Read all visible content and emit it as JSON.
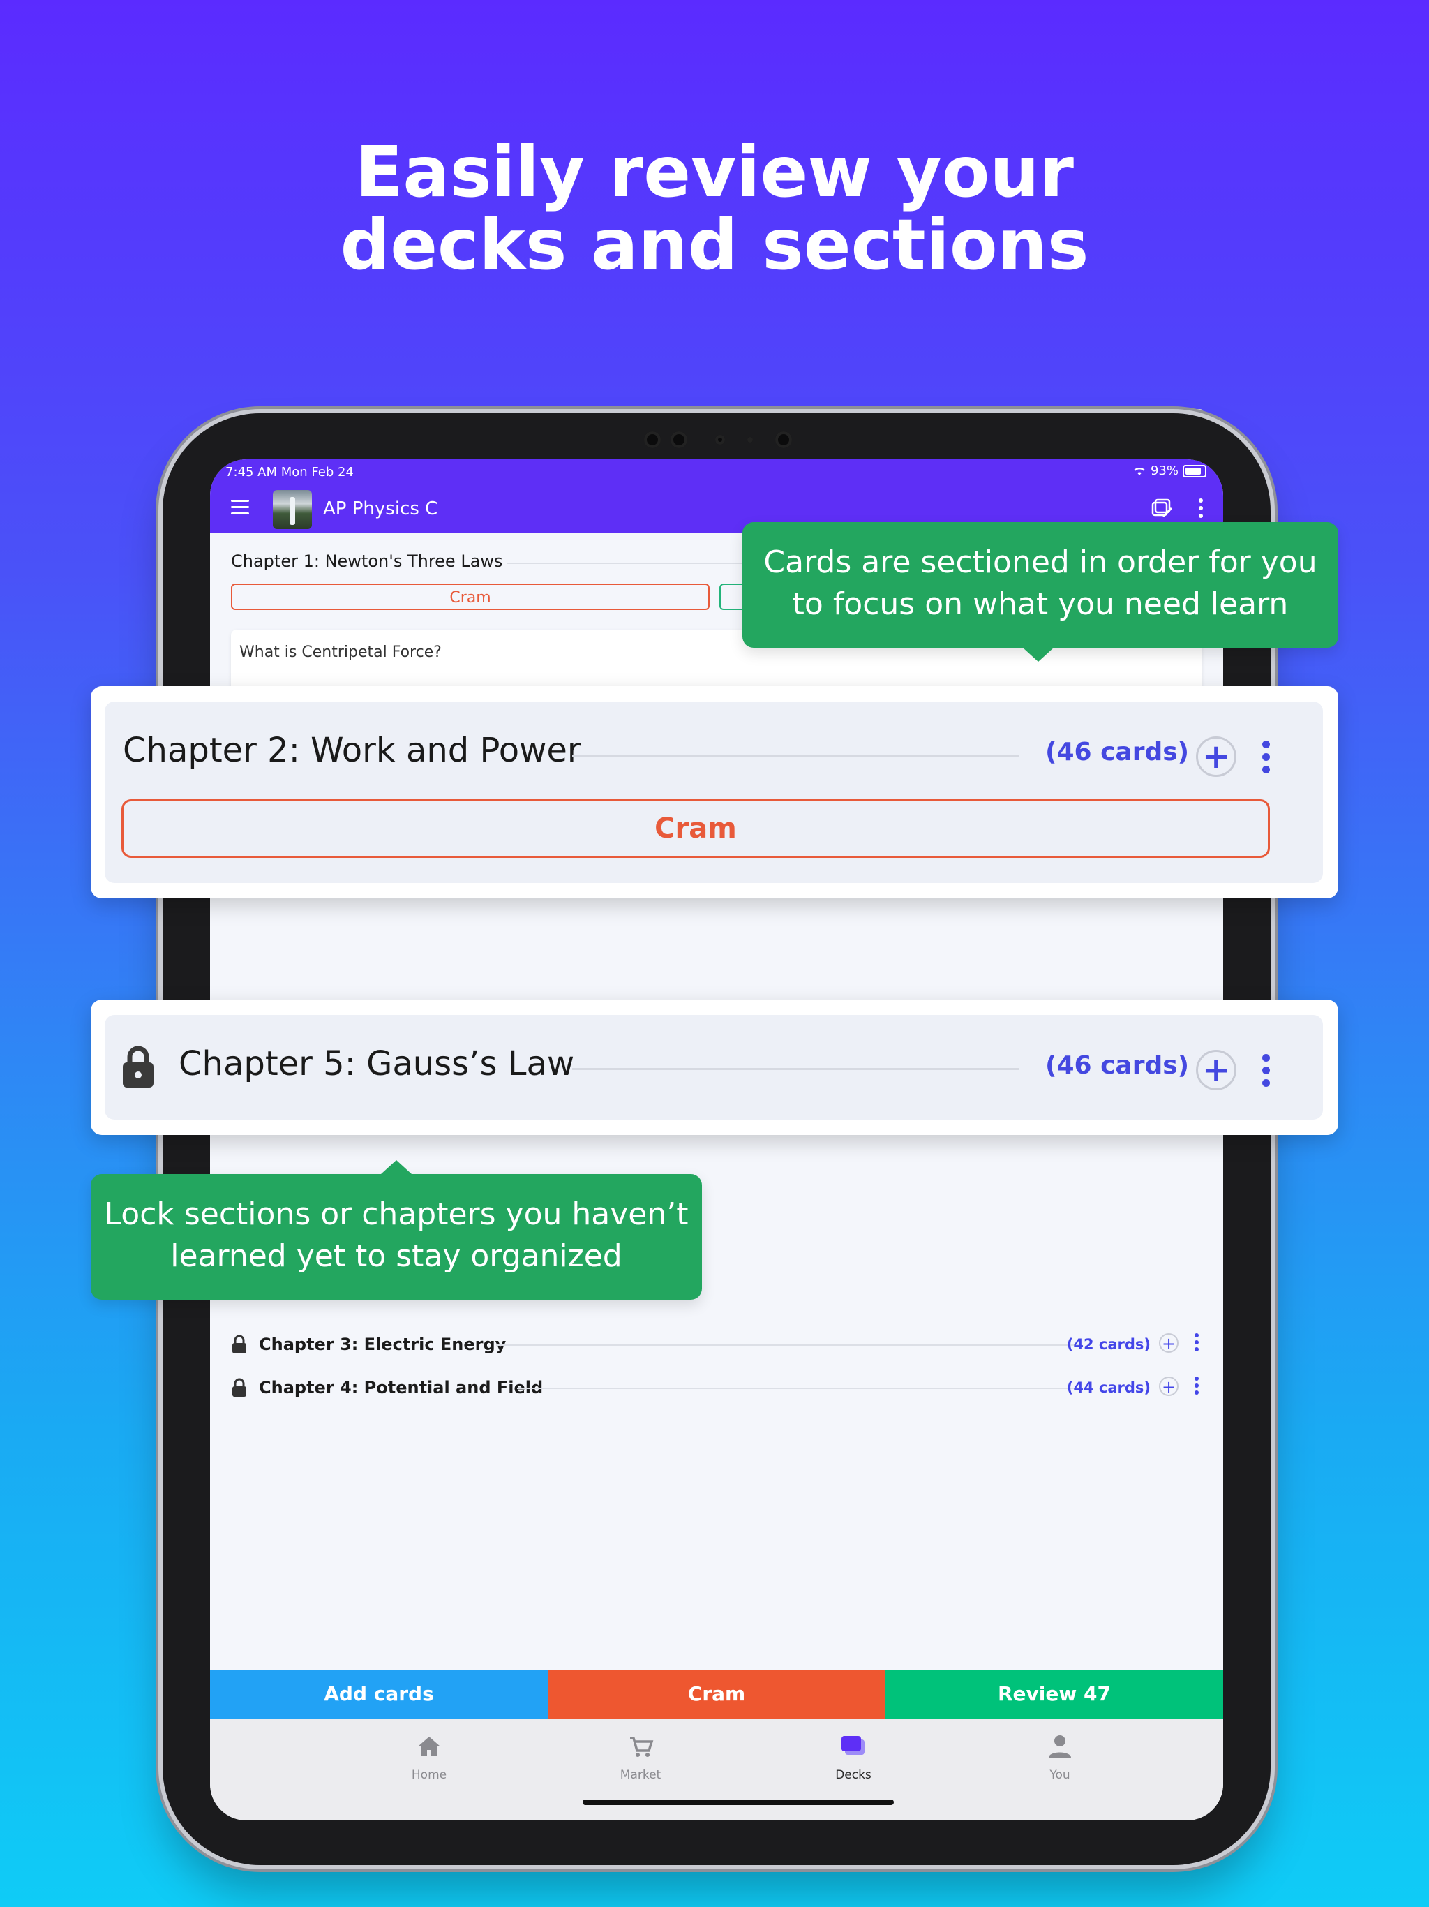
{
  "headline": {
    "line1": "Easily review your",
    "line2": "decks and sections"
  },
  "status_bar": {
    "time": "7:45 AM   Mon Feb 24",
    "battery": "93%"
  },
  "app_bar": {
    "deck_title": "AP Physics C"
  },
  "chapter1": {
    "title": "Chapter 1: Newton's Three Laws",
    "cram_label": "Cram",
    "card_question": "What is Centripetal Force?"
  },
  "sections": [
    {
      "title": "Chapter 3: Electric Energy",
      "count": "(42 cards)",
      "locked": true
    },
    {
      "title": "Chapter 4: Potential and Field",
      "count": "(44 cards)",
      "locked": true
    }
  ],
  "callout_chapter2": {
    "title": "Chapter 2: Work and Power",
    "count": "(46 cards)",
    "cram_label": "Cram"
  },
  "callout_chapter5": {
    "title": "Chapter 5: Gauss’s Law",
    "count": "(46 cards)"
  },
  "bubble_top": {
    "line1": "Cards are sectioned in order for you",
    "line2": "to focus on what you need learn"
  },
  "bubble_bottom": {
    "line1": "Lock sections or chapters you haven’t",
    "line2": "learned yet to stay organized"
  },
  "action_bar": {
    "add_cards": "Add cards",
    "cram": "Cram",
    "review": "Review 47"
  },
  "tabs": [
    {
      "label": "Home",
      "icon": "home-icon"
    },
    {
      "label": "Market",
      "icon": "cart-icon"
    },
    {
      "label": "Decks",
      "icon": "decks-icon"
    },
    {
      "label": "You",
      "icon": "person-icon"
    }
  ],
  "colors": {
    "app_bar": "#5e2ff6",
    "cram": "#e85a3a",
    "add_cards": "#22a2f5",
    "review": "#00c27a",
    "accent": "#4448e0",
    "bubble": "#23a65f"
  }
}
